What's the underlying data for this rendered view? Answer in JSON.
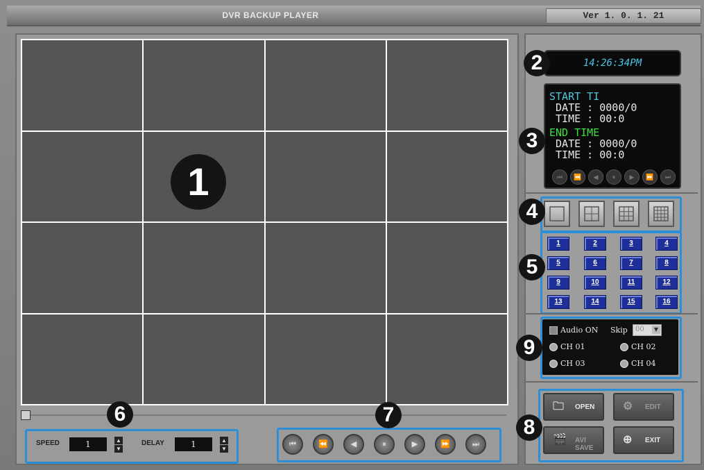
{
  "window": {
    "title": "DVR BACKUP PLAYER",
    "version": "Ver 1. 0. 1. 21"
  },
  "callouts": [
    "1",
    "2",
    "3",
    "4",
    "5",
    "6",
    "7",
    "8",
    "9"
  ],
  "clock": {
    "text": "14:26:34PM"
  },
  "time_panel": {
    "start_label": "START TI",
    "start_date": " DATE : 0000/0",
    "start_time": " TIME : 00:0",
    "end_label": "END TIME",
    "end_date": " DATE : 0000/0",
    "end_time": " TIME : 00:0",
    "controls": [
      "rewind-end-icon",
      "rewind-fast-icon",
      "step-back-icon",
      "pause-icon",
      "play-icon",
      "forward-fast-icon",
      "forward-end-icon"
    ]
  },
  "layouts": [
    "1x1",
    "2x2",
    "3x3",
    "4x4"
  ],
  "channels": [
    "1",
    "2",
    "3",
    "4",
    "5",
    "6",
    "7",
    "8",
    "9",
    "10",
    "11",
    "12",
    "13",
    "14",
    "15",
    "16"
  ],
  "audio": {
    "audio_on_label": "Audio ON",
    "skip_label": "Skip",
    "skip_value": "00",
    "ch01": "CH 01",
    "ch02": "CH 02",
    "ch03": "CH 03",
    "ch04": "CH 04"
  },
  "buttons": {
    "open": "OPEN",
    "edit": "EDIT",
    "avi_save": "AVI SAVE",
    "exit": "EXIT"
  },
  "speed": {
    "label": "SPEED",
    "value": "1"
  },
  "delay": {
    "label": "DELAY",
    "value": "1"
  },
  "playback": [
    "rewind-end-icon",
    "rewind-fast-icon",
    "step-back-icon",
    "pause-icon",
    "play-icon",
    "forward-fast-icon",
    "forward-end-icon"
  ],
  "colors": {
    "accent_blue": "#2d8ed8",
    "clock_cyan": "#49c7e8",
    "start_cyan": "#4fc8d8",
    "end_green": "#3fe03f",
    "channel_blue": "#1f2f9a"
  }
}
